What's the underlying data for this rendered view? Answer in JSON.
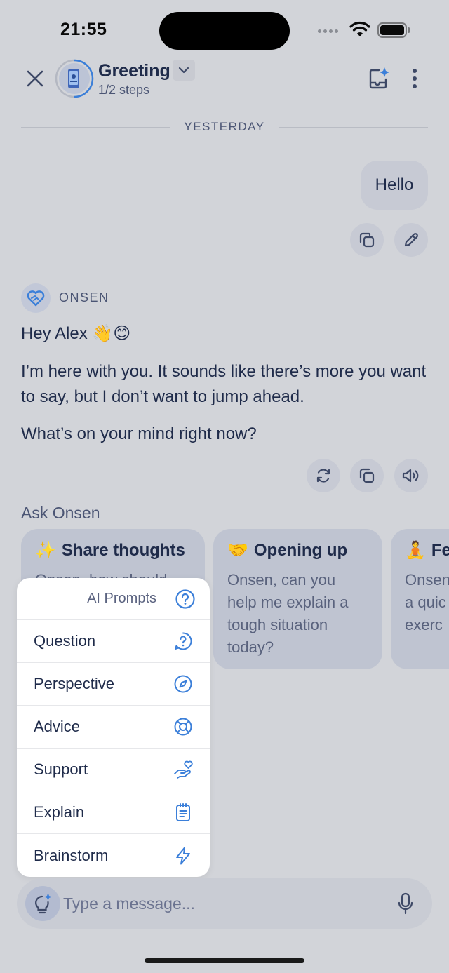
{
  "status_bar": {
    "time": "21:55"
  },
  "header": {
    "title": "Greeting",
    "subtitle": "1/2 steps"
  },
  "divider": {
    "label": "YESTERDAY"
  },
  "user_message": {
    "text": "Hello"
  },
  "assistant": {
    "name": "ONSEN",
    "paragraphs": [
      "Hey Alex 👋😊",
      "I’m here with you. It sounds like there’s more you want to say, but I don’t want to jump ahead.",
      "What’s on your mind right now?"
    ]
  },
  "ask": {
    "label": "Ask Onsen",
    "cards": [
      {
        "emoji": "✨",
        "title": "Share thoughts",
        "body": "Onsen, how should"
      },
      {
        "emoji": "🤝",
        "title": "Opening up",
        "body": "Onsen, can you help me explain a tough situation today?"
      },
      {
        "emoji": "🧘",
        "title": "Fe",
        "body": "Onsen a quic exerc"
      }
    ]
  },
  "prompts_menu": {
    "header": "AI Prompts",
    "items": [
      {
        "label": "Question",
        "icon": "question-bubble-icon"
      },
      {
        "label": "Perspective",
        "icon": "compass-icon"
      },
      {
        "label": "Advice",
        "icon": "lifebuoy-icon"
      },
      {
        "label": "Support",
        "icon": "hand-heart-icon"
      },
      {
        "label": "Explain",
        "icon": "clipboard-icon"
      },
      {
        "label": "Brainstorm",
        "icon": "lightning-icon"
      }
    ]
  },
  "composer": {
    "placeholder": "Type a message..."
  },
  "colors": {
    "accent": "#3b7fd9",
    "background": "#d2d4d9",
    "text": "#1f2b4a"
  }
}
